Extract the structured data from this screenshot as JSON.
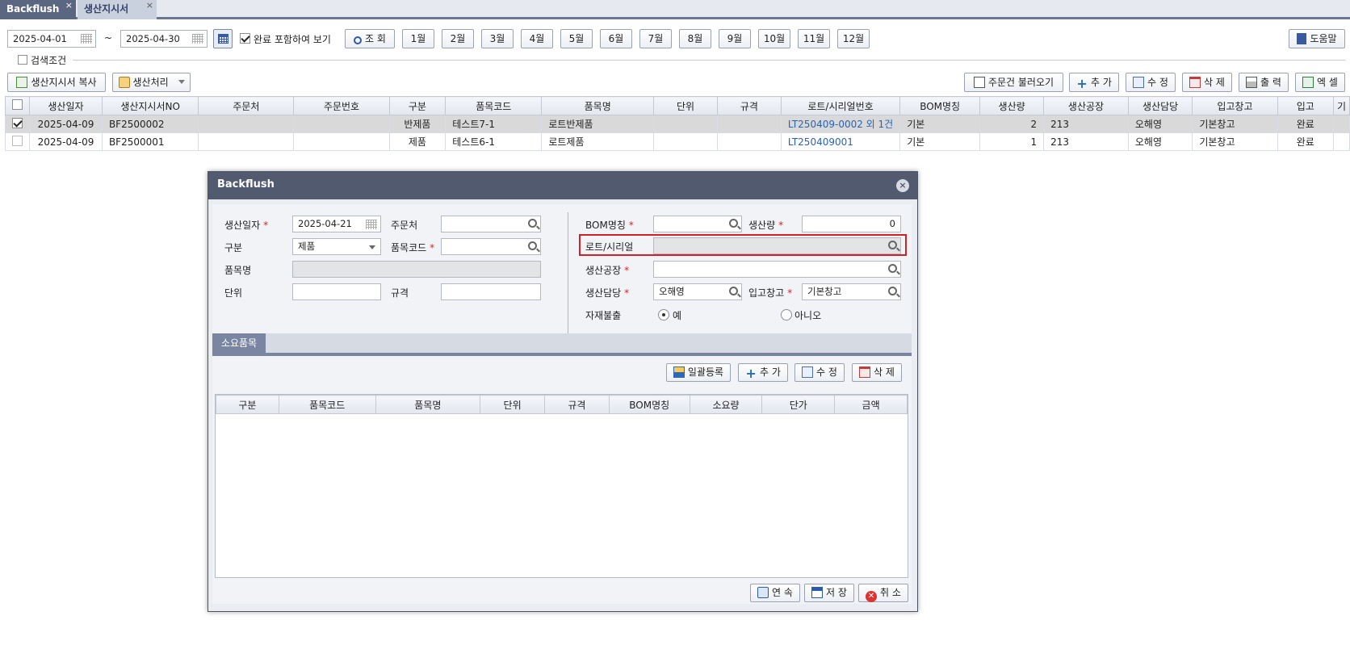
{
  "tabs": [
    {
      "label": "Backflush",
      "close": "×"
    },
    {
      "label": "생산지시서",
      "close": "×"
    }
  ],
  "filters": {
    "date_from": "2025-04-01",
    "separator": "~",
    "date_to": "2025-04-30",
    "include_done_label": "완료 포함하여 보기",
    "search_label": "조 회",
    "months": [
      "1월",
      "2월",
      "3월",
      "4월",
      "5월",
      "6월",
      "7월",
      "8월",
      "9월",
      "10월",
      "11월",
      "12월"
    ],
    "help_label": "도움말",
    "search_conditions_label": "검색조건"
  },
  "actions": {
    "copy_order": "생산지시서 복사",
    "process": "생산처리",
    "load_orders": "주문건 불러오기",
    "add": "추 가",
    "edit": "수 정",
    "delete": "삭 제",
    "print": "출 력",
    "excel": "엑 셀"
  },
  "grid": {
    "columns": [
      "생산일자",
      "생산지시서NO",
      "주문처",
      "주문번호",
      "구분",
      "품목코드",
      "품목명",
      "단위",
      "규격",
      "로트/시리얼번호",
      "BOM명칭",
      "생산량",
      "생산공장",
      "생산담당",
      "입고창고",
      "입고",
      "기"
    ],
    "rows": [
      {
        "checked": true,
        "date": "2025-04-09",
        "no": "BF2500002",
        "customer": "",
        "order_no": "",
        "type": "반제품",
        "code": "테스트7-1",
        "name": "로트반제품",
        "unit": "",
        "spec": "",
        "lot": "LT250409-0002 외 1건",
        "bom": "기본",
        "qty": "2",
        "plant": "213",
        "manager": "오해영",
        "warehouse": "기본창고",
        "in": "완료"
      },
      {
        "checked": false,
        "date": "2025-04-09",
        "no": "BF2500001",
        "customer": "",
        "order_no": "",
        "type": "제품",
        "code": "테스트6-1",
        "name": "로트제품",
        "unit": "",
        "spec": "",
        "lot": "LT250409001",
        "bom": "기본",
        "qty": "1",
        "plant": "213",
        "manager": "오해영",
        "warehouse": "기본창고",
        "in": "완료"
      }
    ]
  },
  "modal": {
    "title": "Backflush",
    "close": "×",
    "required_mark": "*",
    "fields": {
      "prod_date_label": "생산일자",
      "prod_date": "2025-04-21",
      "customer_label": "주문처",
      "customer": "",
      "type_label": "구분",
      "type": "제품",
      "item_code_label": "품목코드",
      "item_code": "",
      "item_name_label": "품목명",
      "item_name": "",
      "unit_label": "단위",
      "unit": "",
      "spec_label": "규격",
      "spec": "",
      "bom_label": "BOM명칭",
      "bom": "",
      "qty_label": "생산량",
      "qty": "0",
      "lot_label": "로트/시리얼",
      "lot": "",
      "plant_label": "생산공장",
      "plant": "",
      "manager_label": "생산담당",
      "manager": "오해영",
      "warehouse_label": "입고창고",
      "warehouse": "기본창고",
      "issue_label": "자재불출",
      "issue_yes": "예",
      "issue_no": "아니오"
    },
    "subtab_label": "소요품목",
    "sub_actions": {
      "bulk": "일괄등록",
      "add": "추 가",
      "edit": "수 정",
      "delete": "삭 제"
    },
    "sub_columns": [
      "구분",
      "품목코드",
      "품목명",
      "단위",
      "규격",
      "BOM명칭",
      "소요량",
      "단가",
      "금액"
    ],
    "footer": {
      "continue": "연 속",
      "save": "저 장",
      "cancel": "취 소"
    }
  },
  "colors": {
    "accent": "#525a70",
    "highlight": "#d1222a",
    "link": "#2a63b5"
  }
}
